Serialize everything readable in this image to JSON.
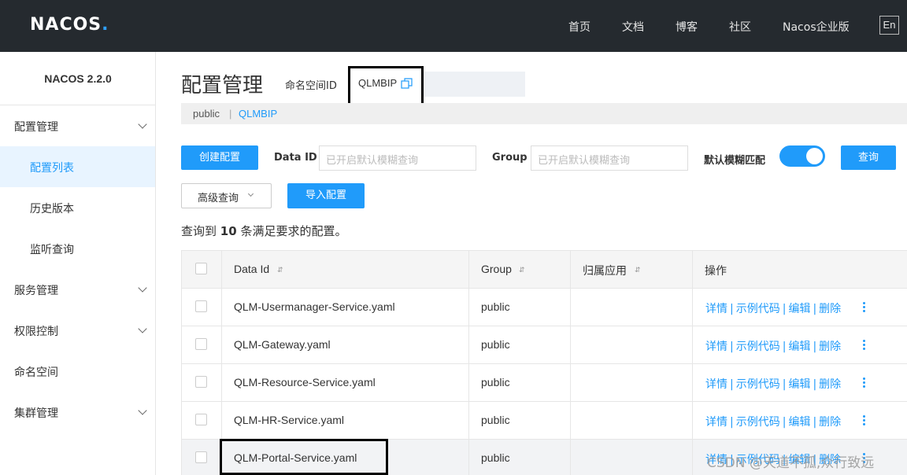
{
  "header": {
    "logo": "NACOS",
    "logo_dot": ".",
    "nav": [
      "首页",
      "文档",
      "博客",
      "社区",
      "Nacos企业版"
    ],
    "lang": "En"
  },
  "sidebar": {
    "version": "NACOS 2.2.0",
    "items": [
      {
        "label": "配置管理",
        "expanded": true
      },
      {
        "label": "配置列表",
        "active": true
      },
      {
        "label": "历史版本"
      },
      {
        "label": "监听查询"
      },
      {
        "label": "服务管理"
      },
      {
        "label": "权限控制"
      },
      {
        "label": "命名空间"
      },
      {
        "label": "集群管理"
      }
    ]
  },
  "main": {
    "title": "配置管理",
    "namespace_label": "命名空间ID",
    "namespace_value": "QLMBIP",
    "breadcrumb": {
      "public": "public",
      "sep": "|",
      "current": "QLMBIP"
    }
  },
  "toolbar": {
    "create_label": "创建配置",
    "data_id_label": "Data ID",
    "data_id_placeholder": "已开启默认模糊查询",
    "group_label": "Group",
    "group_placeholder": "已开启默认模糊查询",
    "fuzzy_label": "默认模糊匹配",
    "fuzzy_on": true,
    "query_label": "查询",
    "advanced_label": "高级查询",
    "import_label": "导入配置"
  },
  "summary": {
    "prefix": "查询到",
    "count": "10",
    "suffix": "条满足要求的配置。"
  },
  "table": {
    "headers": {
      "data_id": "Data Id",
      "group": "Group",
      "app": "归属应用",
      "ops": "操作"
    },
    "rows": [
      {
        "data_id": "QLM-Usermanager-Service.yaml",
        "group": "public",
        "app": ""
      },
      {
        "data_id": "QLM-Gateway.yaml",
        "group": "public",
        "app": ""
      },
      {
        "data_id": "QLM-Resource-Service.yaml",
        "group": "public",
        "app": ""
      },
      {
        "data_id": "QLM-HR-Service.yaml",
        "group": "public",
        "app": ""
      },
      {
        "data_id": "QLM-Portal-Service.yaml",
        "group": "public",
        "app": ""
      }
    ],
    "actions": {
      "detail": "详情",
      "sample": "示例代码",
      "edit": "编辑",
      "delete": "删除",
      "sep": "|"
    }
  },
  "watermark": "CSDN @天道不孤,众行致远",
  "colors": {
    "accent": "#209bfa",
    "topbar": "#252a2f"
  }
}
